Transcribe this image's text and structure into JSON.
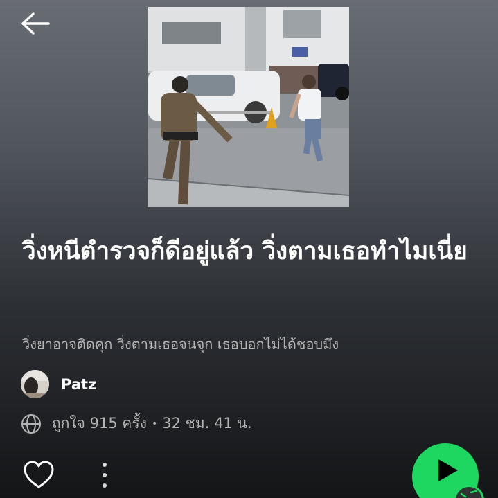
{
  "header": {
    "back_icon": "arrow-left-icon"
  },
  "cover": {
    "alt": "Video frame: a police officer chasing a running man on a street"
  },
  "playlist": {
    "title": "วิ่งหนีตำรวจก็ดีอยู่แล้ว วิ่งตามเธอทำไมเนี่ย",
    "description": "วิ่งยาอาจติดคุก วิ่งตามเธอจนจุก เธอบอกไม่ได้ชอบมึง",
    "owner": {
      "name": "Patz"
    },
    "likes": "ถูกใจ 915 ครั้ง",
    "separator": "•",
    "duration": "32 ชม. 41 น."
  },
  "icons": {
    "globe": "globe-icon",
    "like": "heart-outline-icon",
    "more": "more-vertical-icon",
    "play": "play-icon",
    "shuffle": "shuffle-icon"
  },
  "colors": {
    "accent": "#1ed760",
    "text_primary": "#ffffff",
    "text_secondary": "#b3b3b3"
  }
}
